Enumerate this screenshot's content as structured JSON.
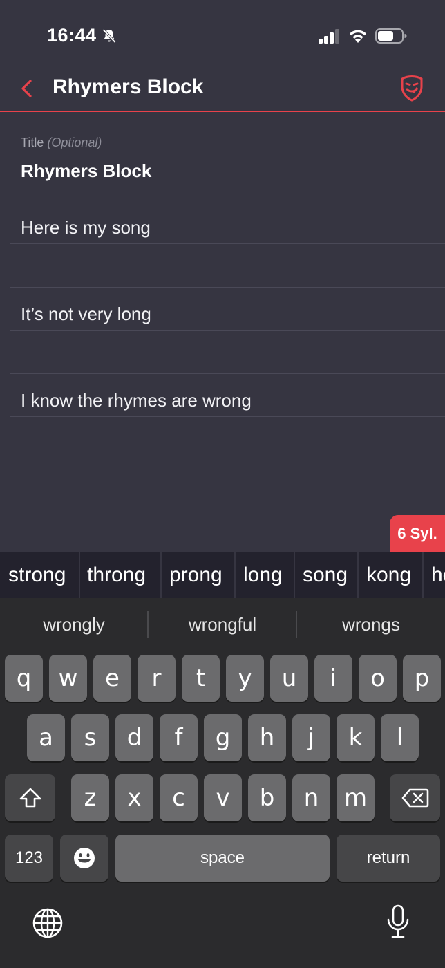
{
  "status": {
    "time": "16:44"
  },
  "header": {
    "title": "Rhymers Block"
  },
  "editor": {
    "title_label": "Title",
    "title_optional": "(Optional)",
    "title_value": "Rhymers Block",
    "lines": [
      "Here is my song",
      "",
      "It’s not very long",
      "",
      "I know the rhymes are wrong",
      "",
      ""
    ]
  },
  "syllables": "6 Syl.",
  "rhymes": [
    "strong",
    "throng",
    "prong",
    "long",
    "song",
    "kong",
    "ho"
  ],
  "keyboard": {
    "suggestions": [
      "wrongly",
      "wrongful",
      "wrongs"
    ],
    "row1": [
      "q",
      "w",
      "e",
      "r",
      "t",
      "y",
      "u",
      "i",
      "o",
      "p"
    ],
    "row2": [
      "a",
      "s",
      "d",
      "f",
      "g",
      "h",
      "j",
      "k",
      "l"
    ],
    "row3": [
      "z",
      "x",
      "c",
      "v",
      "b",
      "n",
      "m"
    ],
    "numbers_label": "123",
    "space_label": "space",
    "return_label": "return"
  },
  "colors": {
    "accent": "#e8424b",
    "background": "#363541"
  }
}
